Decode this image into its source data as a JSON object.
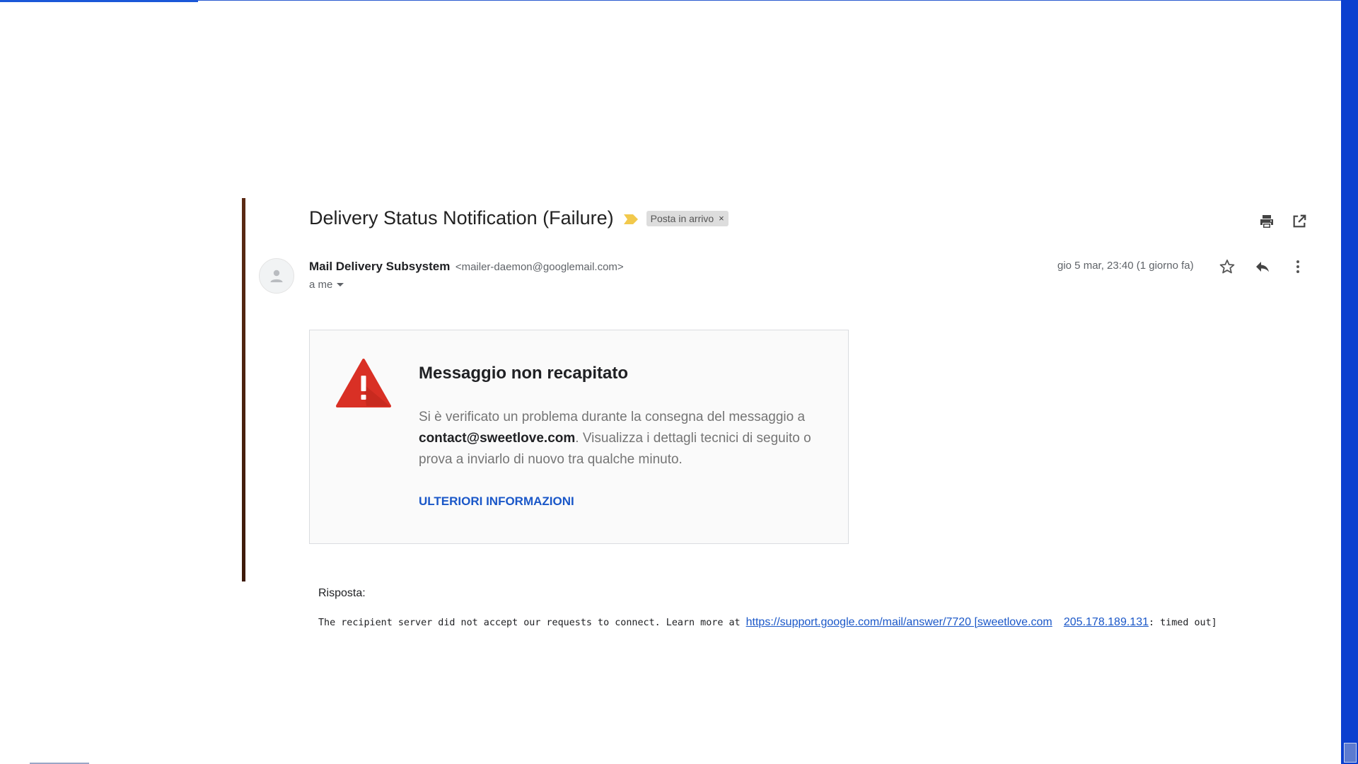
{
  "email": {
    "subject": "Delivery Status Notification (Failure)",
    "label_chip": "Posta in arrivo",
    "label_remove": "×",
    "sender_name": "Mail Delivery Subsystem",
    "sender_email": "<mailer-daemon@googlemail.com>",
    "recipient_line": "a me",
    "date": "gio 5 mar, 23:40 (1 giorno fa)"
  },
  "icons": {
    "importance": "importance-marker-icon",
    "print": "print-icon",
    "new_window": "open-in-new-window-icon",
    "star": "star-icon",
    "reply": "reply-icon",
    "more": "more-vertical-icon",
    "avatar": "person-icon",
    "warning": "warning-triangle-icon"
  },
  "colors": {
    "importance": "#f2c94c",
    "warning": "#d93025",
    "link": "#1a57c8",
    "left_bar": "#4a210d"
  },
  "card": {
    "title": "Messaggio non recapitato",
    "body_before": "Si è verificato un problema durante la consegna del messaggio a ",
    "body_email": "contact@sweetlove.com",
    "body_after": ". Visualizza i dettagli tecnici di seguito o prova a inviarlo di nuovo tra qualche minuto.",
    "link": "ULTERIORI INFORMAZIONI"
  },
  "reply": {
    "label": "Risposta:",
    "text_before": "The recipient server did not accept our requests to connect. Learn more at ",
    "link1": "https://support.google.com/mail/answer/7720 [sweetlove.com",
    "link2": "205.178.189.131",
    "text_after": ": timed out]"
  }
}
